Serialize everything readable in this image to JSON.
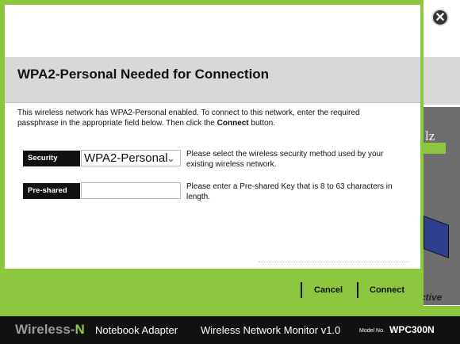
{
  "dialog": {
    "title": "WPA2-Personal Needed for Connection",
    "description_part1": "This wireless network has WPA2-Personal enabled. To connect to this network, enter the required passphrase in the appropriate field below. Then click the ",
    "description_bold": "Connect",
    "description_part2": " button.",
    "security": {
      "label": "Security",
      "selected_value": "WPA2-Personal",
      "help": "Please select the wireless security method used by your existing wireless network."
    },
    "preshared_key": {
      "label": "Pre-shared Key",
      "value": "",
      "help": "Please enter a Pre-shared Key that is 8 to 63 characters in length."
    },
    "buttons": {
      "cancel": "Cancel",
      "connect": "Connect"
    }
  },
  "background": {
    "partial_text": "lz",
    "partial_status": "ctive",
    "close_symbol": "✕"
  },
  "footer": {
    "brand_prefix": "Wireless-",
    "brand_suffix": "N",
    "product": "Notebook Adapter",
    "app_name": "Wireless Network Monitor  v1.0",
    "model_label": "Model No.",
    "model": "WPC300N"
  },
  "colors": {
    "brand_green": "#8dc63f",
    "header_gray": "#d8d8d8",
    "footer_black": "#111111"
  }
}
